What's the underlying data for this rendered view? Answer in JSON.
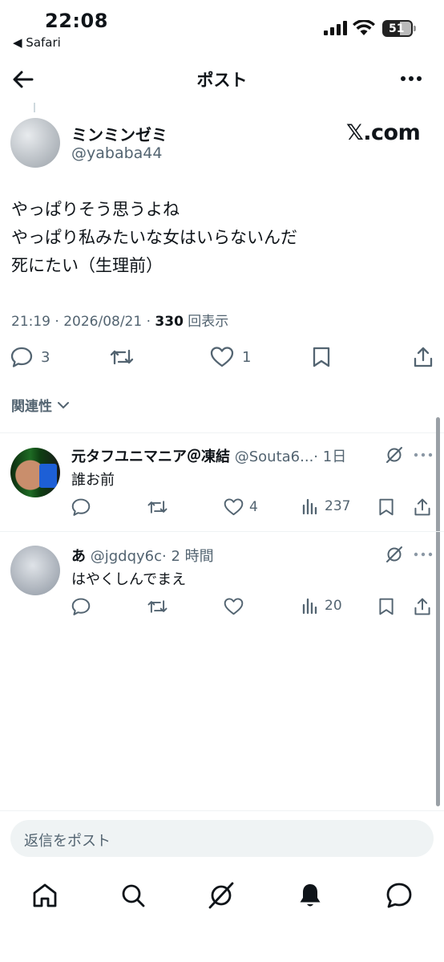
{
  "status_bar": {
    "time": "22:08",
    "back_app": "◀ Safari",
    "battery": "51"
  },
  "header": {
    "title": "ポスト"
  },
  "post": {
    "author_name": "ミンミンゼミ",
    "author_handle": "@yababa44",
    "brand": "𝕏.com",
    "lines": [
      "やっぱりそう思うよね",
      "やっぱり私みたいな女はいらないんだ",
      "死にたい（生理前）"
    ],
    "meta_time": "21:19 · 2026/08/21 · ",
    "views_count": "330",
    "views_label": " 回表示",
    "replies": "3",
    "reposts": "",
    "likes": "1"
  },
  "related_label": "関連性",
  "replies": [
    {
      "name": "元タフユニマニア＠凍結",
      "handle": "@Souta6...",
      "time": "· 1日",
      "text": "誰お前",
      "replies": "",
      "reposts": "",
      "likes": "4",
      "views": "237"
    },
    {
      "name": "あ",
      "handle": "@jgdqy6c",
      "time": "· 2 時間",
      "text": "はやくしんでまえ",
      "replies": "",
      "reposts": "",
      "likes": "",
      "views": "20"
    }
  ],
  "reply_input": {
    "placeholder": "返信をポスト"
  },
  "tabs": [
    "home-icon",
    "search-icon",
    "grok-icon",
    "notifications-icon",
    "messages-icon"
  ]
}
